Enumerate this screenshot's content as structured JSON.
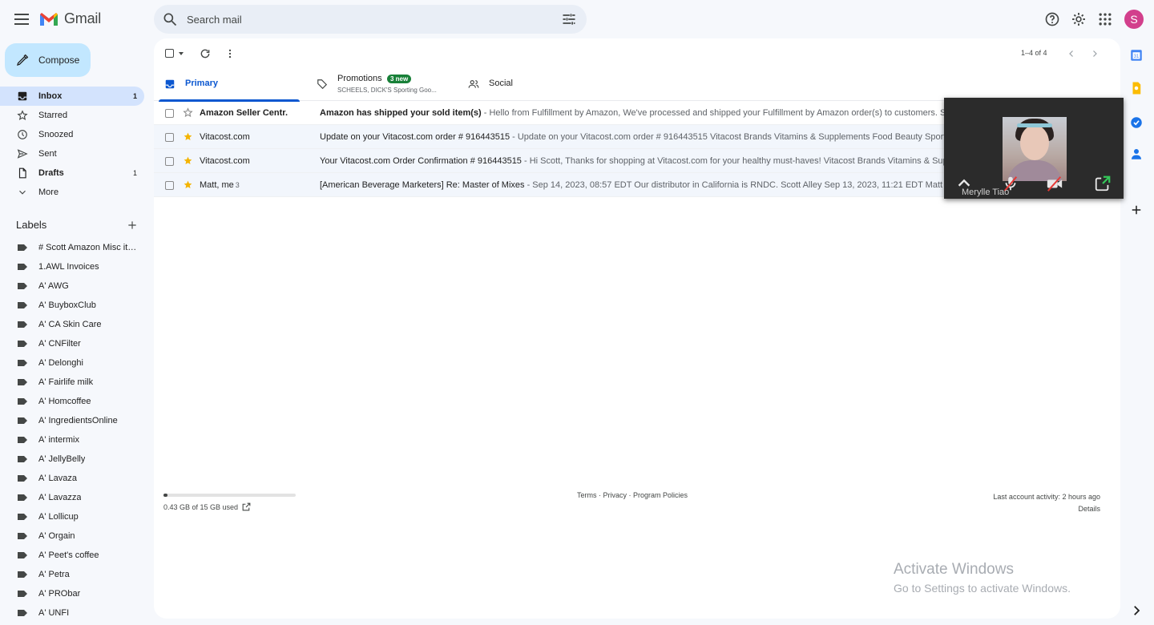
{
  "app": {
    "name": "Gmail"
  },
  "search": {
    "placeholder": "Search mail"
  },
  "avatar": {
    "initial": "S",
    "color": "#d23f8c"
  },
  "compose": {
    "label": "Compose"
  },
  "nav": [
    {
      "label": "Inbox",
      "count": "1",
      "icon": "inbox-icon",
      "active": true
    },
    {
      "label": "Starred",
      "count": "",
      "icon": "star-icon"
    },
    {
      "label": "Snoozed",
      "count": "",
      "icon": "clock-icon"
    },
    {
      "label": "Sent",
      "count": "",
      "icon": "send-icon"
    },
    {
      "label": "Drafts",
      "count": "1",
      "icon": "draft-icon",
      "bold": true
    },
    {
      "label": "More",
      "count": "",
      "icon": "chevron-down-icon"
    }
  ],
  "labels": {
    "heading": "Labels",
    "items": [
      "# Scott Amazon Misc items",
      "1.AWL Invoices",
      "A' AWG",
      "A' BuyboxClub",
      "A' CA Skin Care",
      "A' CNFilter",
      "A' Delonghi",
      "A' Fairlife milk",
      "A' Homcoffee",
      "A' IngredientsOnline",
      "A' intermix",
      "A' JellyBelly",
      "A' Lavaza",
      "A' Lavazza",
      "A' Lollicup",
      "A' Orgain",
      "A' Peet's coffee",
      "A' Petra",
      "A' PRObar",
      "A' UNFI"
    ]
  },
  "toolbar": {
    "pager": "1–4 of 4"
  },
  "tabs": {
    "primary": "Primary",
    "promotions": "Promotions",
    "promotions_badge": "3 new",
    "promotions_sub": "SCHEELS, DICK'S Sporting Goo...",
    "social": "Social"
  },
  "emails": [
    {
      "sender": "Amazon Seller Centr.",
      "count": "",
      "starred": false,
      "unread": true,
      "subject": "Amazon has shipped your sold item(s)",
      "snippet": " - Hello from Fulfillment by Amazon, We've processed and shipped your Fulfillment by Amazon order(s) to customers. See details"
    },
    {
      "sender": "Vitacost.com",
      "count": "",
      "starred": true,
      "unread": false,
      "subject": "Update on your Vitacost.com order # 916443515",
      "snippet": " - Update on your Vitacost.com order # 916443515            Vitacost Brands Vitamins & Supplements Food Beauty Sports"
    },
    {
      "sender": "Vitacost.com",
      "count": "",
      "starred": true,
      "unread": false,
      "subject": "Your Vitacost.com Order Confirmation # 916443515",
      "snippet": " - Hi Scott, Thanks for shopping at Vitacost.com for your healthy must-haves!            Vitacost Brands Vitamins & Supplements"
    },
    {
      "sender": "Matt, me",
      "count": "3",
      "starred": true,
      "unread": false,
      "subject": "[American Beverage Marketers] Re: Master of Mixes",
      "snippet": " - Sep 14, 2023, 08:57 EDT Our distributor in California is RNDC. Scott Alley Sep 13, 2023, 11:21 EDT Matt Dorgay (Agent)"
    }
  ],
  "footer": {
    "storage": "0.43 GB of 15 GB used",
    "storage_fraction": 0.029,
    "links": "Terms · Privacy · Program Policies",
    "activity": "Last account activity: 2 hours ago",
    "details": "Details"
  },
  "video": {
    "name": "Merylle Tiao"
  },
  "watermark": {
    "line1": "Activate Windows",
    "line2": "Go to Settings to activate Windows."
  },
  "colors": {
    "accent": "#0b57d0",
    "compose_bg": "#c2e7ff",
    "star": "#f4b400",
    "badge": "#188038"
  }
}
